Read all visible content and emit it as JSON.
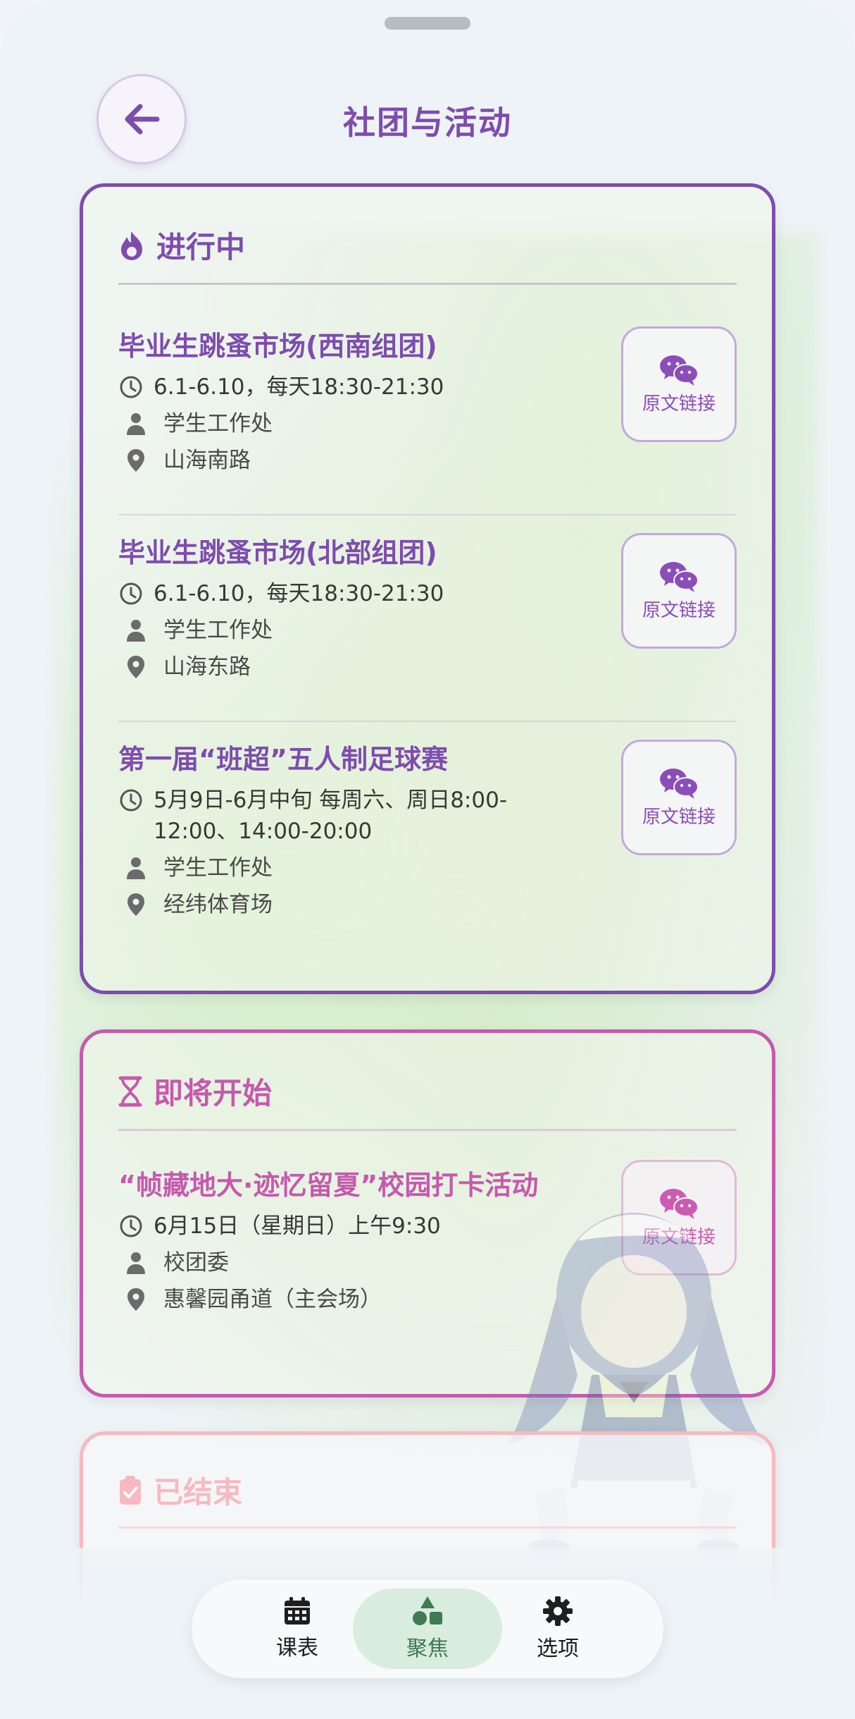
{
  "header": {
    "title": "社团与活动"
  },
  "sections": {
    "ongoing": {
      "heading": "进行中",
      "color": "#7e4cae",
      "items": [
        {
          "title": "毕业生跳蚤市场(西南组团)",
          "time": "6.1-6.10，每天18:30-21:30",
          "organizer": "学生工作处",
          "location": "山海南路",
          "link_label": "原文链接"
        },
        {
          "title": "毕业生跳蚤市场(北部组团)",
          "time": "6.1-6.10，每天18:30-21:30",
          "organizer": "学生工作处",
          "location": "山海东路",
          "link_label": "原文链接"
        },
        {
          "title": "第一届“班超”五人制足球赛",
          "time": "5月9日-6月中旬 每周六、周日8:00-12:00、14:00-20:00",
          "organizer": "学生工作处",
          "location": "经纬体育场",
          "link_label": "原文链接"
        }
      ]
    },
    "upcoming": {
      "heading": "即将开始",
      "color": "#c659ae",
      "items": [
        {
          "title": "“帧藏地大·迹忆留夏”校园打卡活动",
          "time": "6月15日（星期日）上午9:30",
          "organizer": "校团委",
          "location": "惠馨园甬道（主会场）",
          "link_label": "原文链接"
        }
      ]
    },
    "ended": {
      "heading": "已结束",
      "color": "#f7b9c0"
    }
  },
  "bottom_nav": {
    "items": [
      {
        "label": "课表",
        "icon": "calendar-icon"
      },
      {
        "label": "聚焦",
        "icon": "shapes-icon",
        "active": true
      },
      {
        "label": "选项",
        "icon": "gear-icon"
      }
    ]
  }
}
